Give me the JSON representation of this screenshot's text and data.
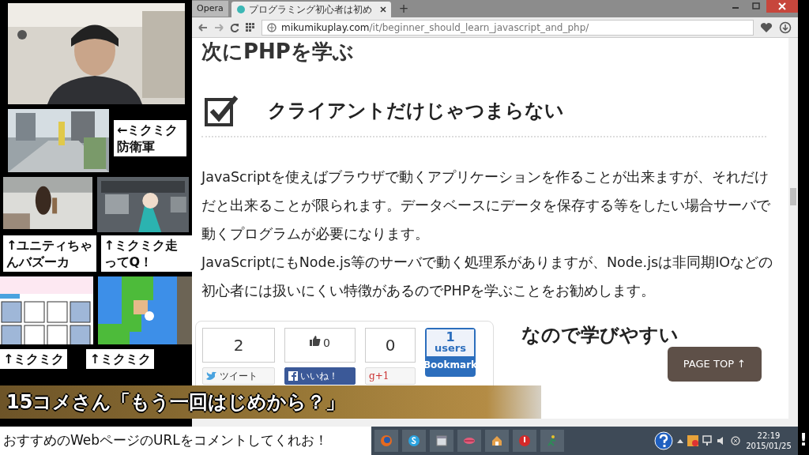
{
  "left_panel": {
    "captions": [
      {
        "text": "←ミクミク防衛軍"
      },
      {
        "text": "↑ユニティちゃんバズーカ"
      },
      {
        "text": "↑ミクミク走ってQ！"
      },
      {
        "text": "↑ミクミク"
      },
      {
        "text": "↑ミクミク"
      }
    ]
  },
  "browser": {
    "menu_label": "Opera",
    "tabs": [
      {
        "title": "プログラミング初心者は初め",
        "selected": true
      }
    ],
    "new_tab": "+",
    "url_domain": "mikumikuplay.com",
    "url_path": "/it/beginner_should_learn_javascript_and_php/"
  },
  "article": {
    "top_heading": "次にPHPを学ぶ",
    "section_title": "クライアントだけじゃつまらない",
    "checked": true,
    "paragraphs": [
      "JavaScriptを使えばブラウザで動くアプリケーションを作ることが出来ますが、それだけだと出来ることが限られます。データベースにデータを保存する等をしたい場合サーバで動くプログラムが必要になります。",
      "JavaScriptにもNode.js等のサーバで動く処理系がありますが、Node.jsは非同期IOなどの初心者には扱いにくい特徴があるのでPHPを学ぶことをお勧めします。"
    ],
    "next_heading": "なので学びやすい"
  },
  "share": {
    "counts": [
      {
        "kind": "plain",
        "text": "2"
      },
      {
        "kind": "like",
        "text": "0"
      },
      {
        "kind": "plain",
        "text": "0"
      }
    ],
    "hatena": {
      "count": "1",
      "unit": "users",
      "label": "Bookmark"
    },
    "buttons": [
      {
        "kind": "twitter",
        "label": "ツイート"
      },
      {
        "kind": "facebook",
        "label": "いいね！"
      },
      {
        "kind": "gplus",
        "label": "g+1"
      }
    ]
  },
  "page_top": "PAGE TOP ↑",
  "banner": "15コメさん「もう一回はじめから？」",
  "request": "おすすめのWebページのURLをコメントしてくれお！",
  "taskbar": {
    "apps": [
      {
        "kind": "firefox"
      },
      {
        "kind": "skype"
      },
      {
        "kind": "window"
      },
      {
        "kind": "lips"
      },
      {
        "kind": "house"
      },
      {
        "kind": "stop"
      },
      {
        "kind": "runner"
      }
    ],
    "time": "22:19",
    "date": "2015/01/25"
  },
  "alert": "!"
}
